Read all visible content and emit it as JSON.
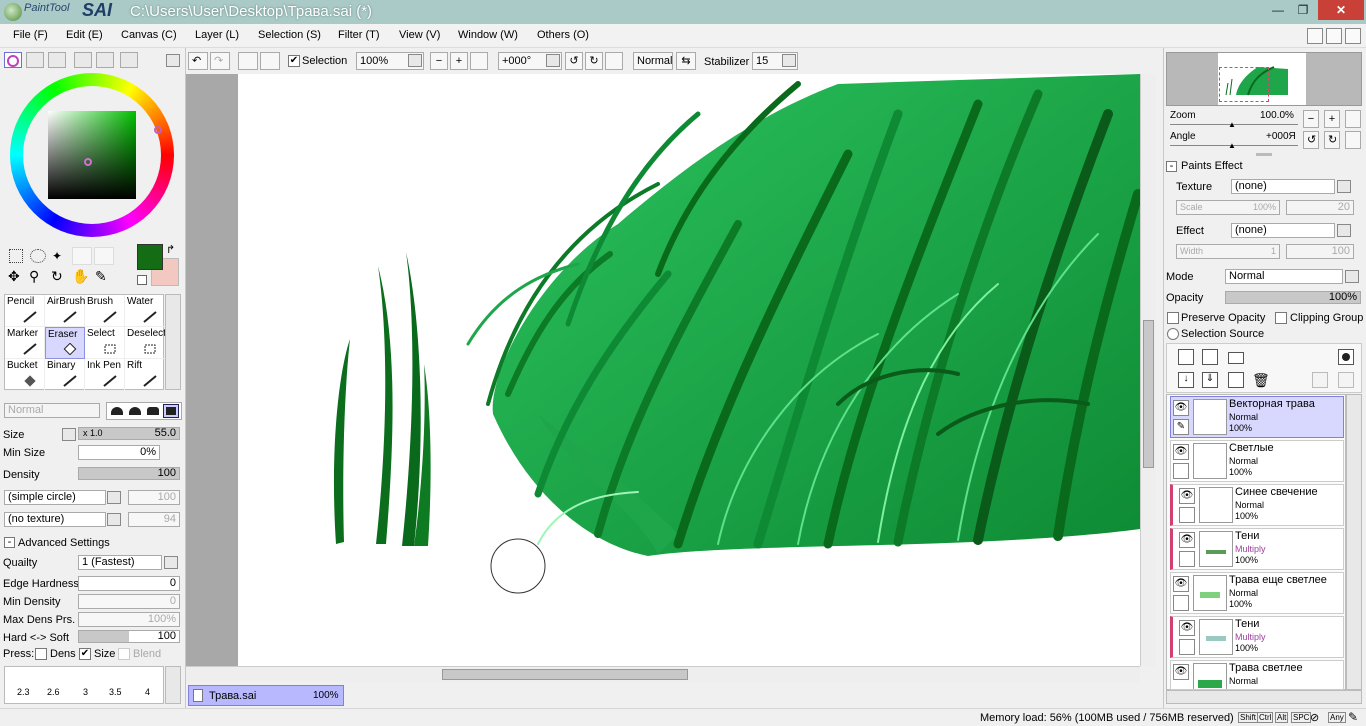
{
  "window": {
    "logo_small": "PaintTool",
    "logo_big": "SAI",
    "title": "C:\\Users\\User\\Desktop\\Трава.sai (*)",
    "min_glyph": "—",
    "max_glyph": "❐",
    "close_glyph": "✕"
  },
  "menu": [
    "File (F)",
    "Edit (E)",
    "Canvas (C)",
    "Layer (L)",
    "Selection (S)",
    "Filter (T)",
    "View (V)",
    "Window (W)",
    "Others (O)"
  ],
  "toolbar": {
    "selection_label": "Selection",
    "zoom": "100%",
    "angle": "+000°",
    "blend": "Normal",
    "stabilizer_label": "Stabilizer",
    "stabilizer_value": "15"
  },
  "tools": [
    {
      "label": "Pencil"
    },
    {
      "label": "AirBrush"
    },
    {
      "label": "Brush"
    },
    {
      "label": "Water"
    },
    {
      "label": "Marker"
    },
    {
      "label": "Eraser"
    },
    {
      "label": "Select"
    },
    {
      "label": "Deselect"
    },
    {
      "label": "Bucket"
    },
    {
      "label": "Binary"
    },
    {
      "label": "Ink Pen"
    },
    {
      "label": "Rift"
    }
  ],
  "brush": {
    "mode": "Normal",
    "size_label": "Size",
    "size_mult": "x 1.0",
    "size_value": "55.0",
    "min_size_label": "Min Size",
    "min_size_value": "0%",
    "density_label": "Density",
    "density_value": "100",
    "shape": "(simple circle)",
    "shape_value": "100",
    "texture": "(no texture)",
    "texture_value": "94",
    "advanced_label": "Advanced Settings",
    "quality_label": "Quailty",
    "quality_value": "1 (Fastest)",
    "edge_label": "Edge Hardness",
    "edge_value": "0",
    "min_density_label": "Min Density",
    "min_density_value": "0",
    "max_dens_label": "Max Dens Prs.",
    "max_dens_value": "100%",
    "hard_soft_label": "Hard <-> Soft",
    "hard_soft_value": "100",
    "press_label": "Press:",
    "press_dens": "Dens",
    "press_size": "Size",
    "press_blend": "Blend",
    "sizes": [
      "2.3",
      "2.6",
      "3",
      "3.5",
      "4"
    ]
  },
  "document": {
    "tab_name": "Трава.sai",
    "tab_zoom": "100%"
  },
  "status": {
    "memory": "Memory load: 56% (100MB used / 756MB reserved)",
    "keys": [
      "Shift",
      "Ctrl",
      "Alt",
      "SPC",
      "Any"
    ]
  },
  "navigator": {
    "zoom_label": "Zoom",
    "zoom_value": "100.0%",
    "angle_label": "Angle",
    "angle_value": "+000Я"
  },
  "paints_effect": {
    "title": "Paints Effect",
    "texture_label": "Texture",
    "texture_value": "(none)",
    "scale_label": "Scale",
    "scale_value": "100%",
    "scale_value2": "20",
    "effect_label": "Effect",
    "effect_value": "(none)",
    "width_label": "Width",
    "width_value": "1",
    "width_value2": "100"
  },
  "layer_props": {
    "mode_label": "Mode",
    "mode_value": "Normal",
    "opacity_label": "Opacity",
    "opacity_value": "100%",
    "preserve_opacity": "Preserve Opacity",
    "clipping_group": "Clipping Group",
    "selection_source": "Selection Source"
  },
  "layers": [
    {
      "name": "Векторная трава",
      "mode": "Normal",
      "opacity": "100%",
      "active": true,
      "clip": false
    },
    {
      "name": "Светлые",
      "mode": "Normal",
      "opacity": "100%",
      "active": false,
      "clip": false
    },
    {
      "name": "Синее свечение",
      "mode": "Normal",
      "opacity": "100%",
      "active": false,
      "clip": true
    },
    {
      "name": "Тени",
      "mode": "Multiply",
      "opacity": "100%",
      "active": false,
      "clip": true
    },
    {
      "name": "Трава еще светлее",
      "mode": "Normal",
      "opacity": "100%",
      "active": false,
      "clip": false
    },
    {
      "name": "Тени",
      "mode": "Multiply",
      "opacity": "100%",
      "active": false,
      "clip": true
    },
    {
      "name": "Трава светлее",
      "mode": "Normal",
      "opacity": "",
      "active": false,
      "clip": false
    }
  ],
  "colors": {
    "titlebar": "#a9cac6",
    "foreground": "#146c14",
    "background": "#f2c8c0",
    "active_layer": "#d8d8ff",
    "grass_dark": "#0a6e1e",
    "grass_mid": "#1fa64a",
    "grass_light": "#5fe08a"
  }
}
